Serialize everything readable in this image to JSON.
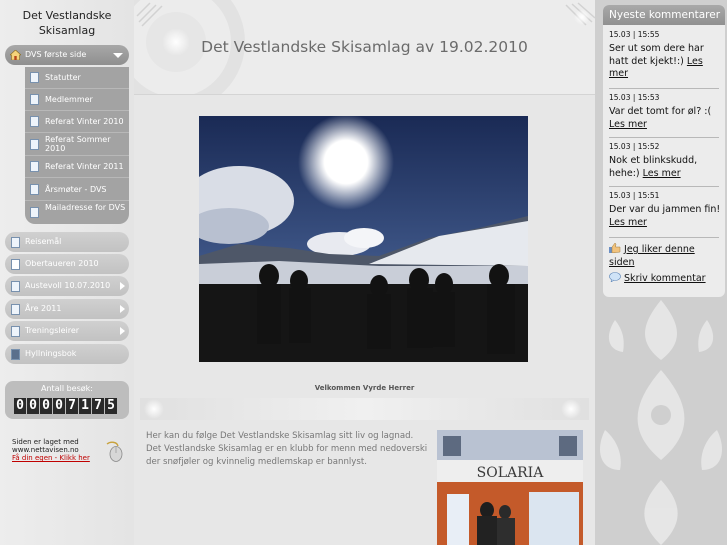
{
  "site": {
    "title_line1": "Det Vestlandske",
    "title_line2": "Skisamlag"
  },
  "nav": {
    "main": {
      "label": "DVS første side"
    },
    "subitems": [
      {
        "label": "Statutter"
      },
      {
        "label": "Medlemmer"
      },
      {
        "label": "Referat Vinter 2010"
      },
      {
        "label": "Referat Sommer 2010"
      },
      {
        "label": "Referat Vinter 2011"
      },
      {
        "label": "Årsmøter - DVS"
      },
      {
        "label": "Mailadresse for DVS"
      }
    ],
    "items": [
      {
        "label": "Reisemål"
      },
      {
        "label": "Obertaueren 2010"
      },
      {
        "label": "Austevoll 10.07.2010"
      },
      {
        "label": "Åre 2011"
      },
      {
        "label": "Treningsleirer"
      },
      {
        "label": "Hyllningsbok"
      }
    ]
  },
  "counter": {
    "label": "Antall besøk:",
    "digits": [
      "0",
      "0",
      "0",
      "0",
      "7",
      "1",
      "7",
      "5"
    ]
  },
  "promo": {
    "line1": "Siden er laget med",
    "line2": "www.nettavisen.no",
    "link": "Få din egen - Klikk her"
  },
  "main": {
    "title": "Det Vestlandske Skisamlag av 19.02.2010",
    "caption": "Velkommen Vyrde Herrer",
    "intro": "Her kan du følge Det Vestlandske Skisamlag sitt liv og lagnad. Det Vestlandske Skisamlag er en klubb for menn med nedoverski der snøfjøler og kvinnelig medlemskap er bannlyst.",
    "photo2_sign": "SOLARIA"
  },
  "comments": {
    "header": "Nyeste kommentarer",
    "items": [
      {
        "time": "15.03 | 15:55",
        "text": "Ser ut som dere har hatt det kjekt!:)",
        "link": "Les mer"
      },
      {
        "time": "15.03 | 15:53",
        "text": "Var det tomt for øl? :(",
        "link": "Les mer"
      },
      {
        "time": "15.03 | 15:52",
        "text": "Nok et blinkskudd, hehe:)",
        "link": "Les mer"
      },
      {
        "time": "15.03 | 15:51",
        "text": "Der var du jammen fin!",
        "link": "Les mer"
      }
    ],
    "like_label": "Jeg liker denne siden",
    "comment_label": "Skriv kommentar"
  },
  "colors": {
    "nav_active": "#999999",
    "nav_item": "#c8c8c8",
    "link_red": "#c00000"
  }
}
